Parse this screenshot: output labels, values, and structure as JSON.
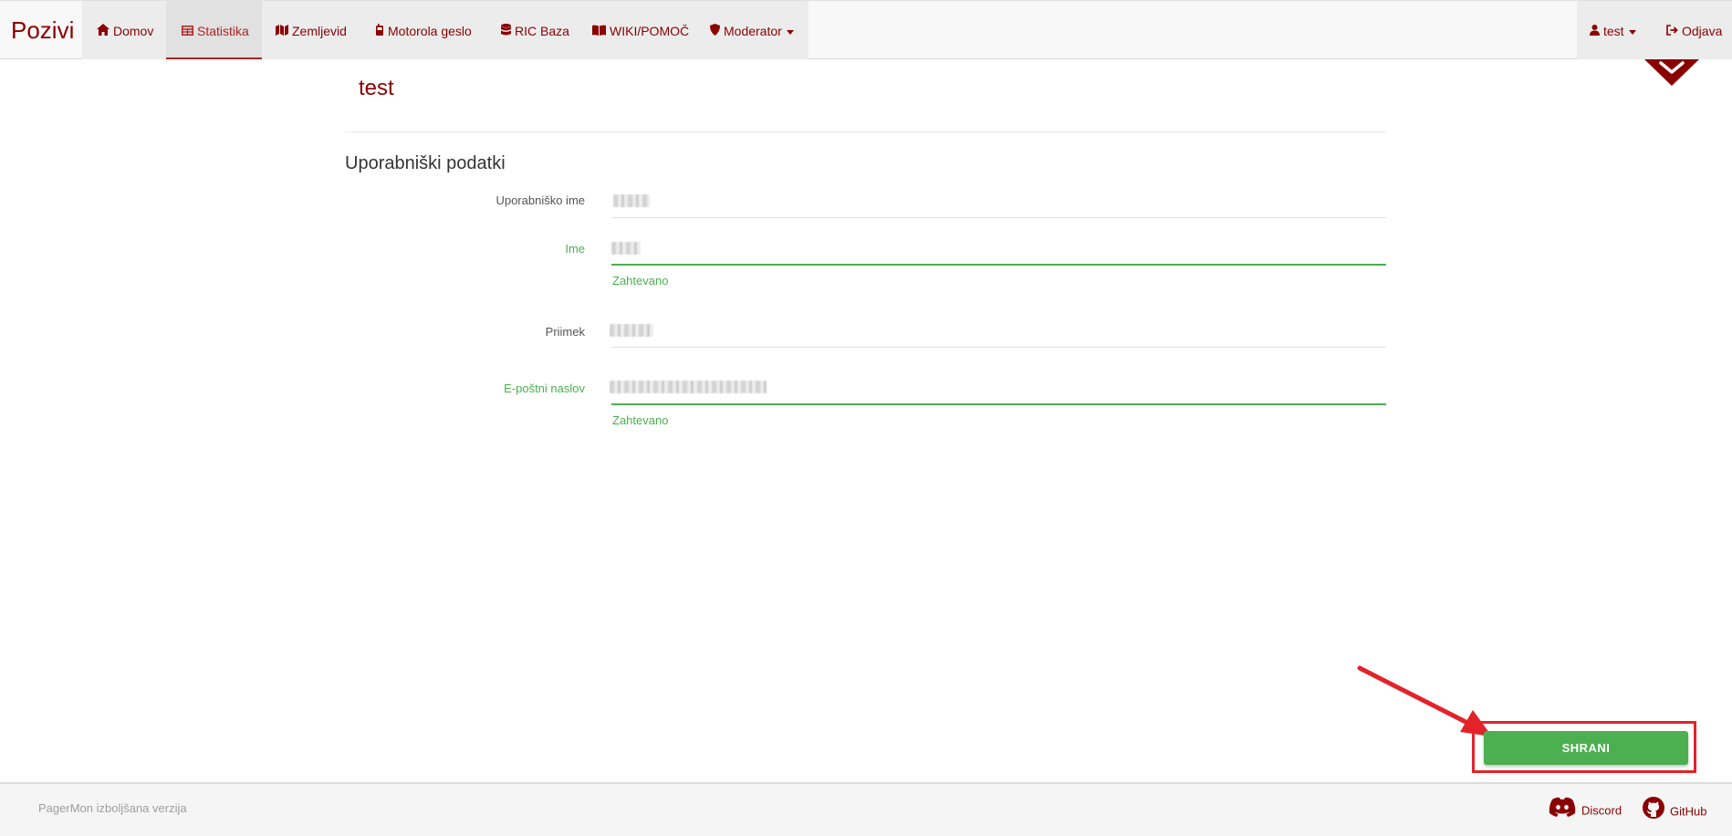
{
  "navbar": {
    "brand": "Pozivi",
    "items": [
      {
        "label": "Domov",
        "icon": "home-icon"
      },
      {
        "label": "Statistika",
        "icon": "table-icon",
        "active": true
      },
      {
        "label": "Zemljevid",
        "icon": "map-icon"
      },
      {
        "label": "Motorola geslo",
        "icon": "pager-icon"
      },
      {
        "label": "RIC Baza",
        "icon": "database-icon"
      },
      {
        "label": "WIKI/POMOČ",
        "icon": "book-icon"
      },
      {
        "label": "Moderator",
        "icon": "shield-icon",
        "dropdown": true
      }
    ],
    "user_label": "test",
    "logout_label": "Odjava"
  },
  "page": {
    "title": "test",
    "section_title": "Uporabniški podatki"
  },
  "form": {
    "username_label": "Uporabniško ime",
    "first_name_label": "Ime",
    "first_name_hint": "Zahtevano",
    "last_name_label": "Priimek",
    "email_label": "E-poštni naslov",
    "email_hint": "Zahtevano"
  },
  "actions": {
    "save_label": "SHRANI"
  },
  "footer": {
    "text": "PagerMon izboljšana verzija",
    "discord_label": "Discord",
    "github_label": "GitHub"
  },
  "colors": {
    "brand": "#8b0000",
    "valid": "#4caf50",
    "annotation": "#e2232a"
  }
}
